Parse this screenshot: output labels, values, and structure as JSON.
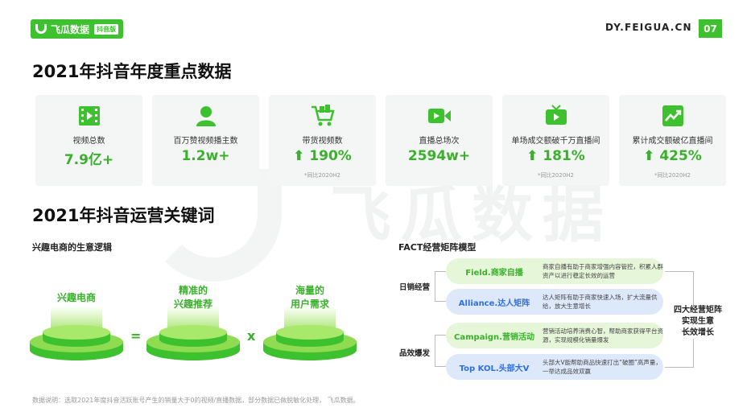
{
  "header": {
    "brand": "飞瓜数据",
    "brand_tag": "抖音版",
    "site": "DY.FEIGUA.CN",
    "page_number": "07"
  },
  "watermark": "飞瓜数据",
  "section1": {
    "title": "2021年抖音年度重点数据",
    "cards": [
      {
        "icon": "film-icon",
        "label": "视频总数",
        "value": "7.9亿+",
        "arrow": false,
        "note": ""
      },
      {
        "icon": "user-icon",
        "label": "百万赞视频播主数",
        "value": "1.2w+",
        "arrow": false,
        "note": ""
      },
      {
        "icon": "cart-icon",
        "label": "带货视频数",
        "value": "190%",
        "arrow": true,
        "note": "*同比2020H2"
      },
      {
        "icon": "video-camera-icon",
        "label": "直播总场次",
        "value": "2594w+",
        "arrow": false,
        "note": ""
      },
      {
        "icon": "tv-icon",
        "label": "单场成交额破千万直播间",
        "value": "181%",
        "arrow": true,
        "note": "*同比2020H2"
      },
      {
        "icon": "trend-chart-icon",
        "label": "累计成交额破亿直播间",
        "value": "425%",
        "arrow": true,
        "note": "*同比2020H2"
      }
    ]
  },
  "section2": {
    "title": "2021年抖音运营关键词",
    "left_subtitle": "兴趣电商的生意逻辑",
    "platforms": [
      {
        "label1": "兴趣电商",
        "label2": ""
      },
      {
        "label1": "精准的",
        "label2": "兴趣推荐"
      },
      {
        "label1": "海量的",
        "label2": "用户需求"
      }
    ],
    "ops": {
      "equals": "=",
      "times": "x"
    },
    "right_subtitle": "FACT经营矩阵模型",
    "side_labels": {
      "daily": "日销经营",
      "burst": "品效爆发"
    },
    "fact": [
      {
        "name": "Field.商家自播",
        "desc": "商家自播有助于商家增强内容管控，积累人群资产以进行稳定长效的运营",
        "style": "green"
      },
      {
        "name": "Alliance.达人矩阵",
        "desc": "达人矩阵有助于商家快速入场，扩大流量供给，放大生意增长",
        "style": "blue"
      },
      {
        "name": "Campaign.营销活动",
        "desc": "营销活动培养消费心智，帮助商家获得平台资源，实现规模化销量爆发",
        "style": "green"
      },
      {
        "name": "Top KOL.头部大V",
        "desc": "头部大V能帮助商品快速打出“破圈”高声量，一举达成品效双赢",
        "style": "blue"
      }
    ],
    "result": {
      "l1": "四大经营矩阵",
      "l2": "实现生意",
      "l3": "长效增长"
    }
  },
  "footer": "数据说明：选取2021年度抖音活跃账号产生的销量大于0的视频/直播数据，部分数据已做脱敏化处理， 飞瓜数据。",
  "colors": {
    "accent": "#3ec12f",
    "value": "#3ab02c",
    "blue": "#2f6ee0"
  }
}
